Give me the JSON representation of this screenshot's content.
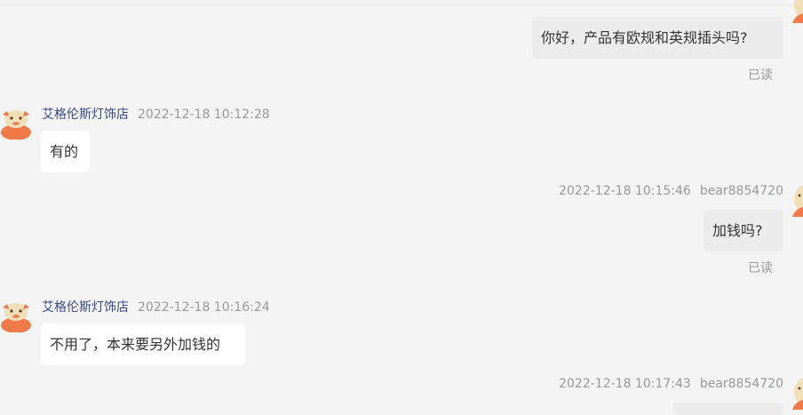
{
  "messages": [
    {
      "text": "你好，产品有欧规和英规插头吗?",
      "status": "已读"
    },
    {
      "shop": "艾格伦斯灯饰店",
      "time": "2022-12-18 10:12:28",
      "text": "有的"
    },
    {
      "time": "2022-12-18 10:15:46",
      "user": "bear8854720",
      "text": "加钱吗?",
      "status": "已读"
    },
    {
      "shop": "艾格伦斯灯饰店",
      "time": "2022-12-18 10:16:24",
      "text": "不用了，本来要另外加钱的"
    },
    {
      "time": "2022-12-18 10:17:43",
      "user": "bear8854720",
      "text": ""
    }
  ]
}
